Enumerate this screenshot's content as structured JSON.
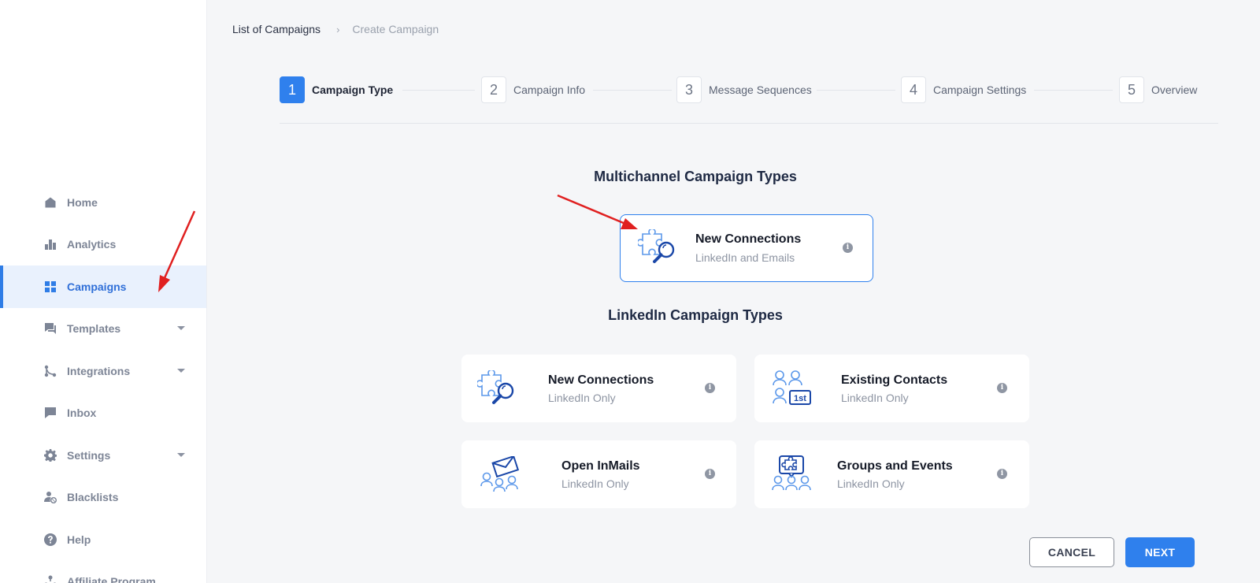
{
  "sidebar": {
    "items": [
      {
        "label": "Home",
        "icon": "home-icon"
      },
      {
        "label": "Analytics",
        "icon": "bar-chart-icon"
      },
      {
        "label": "Campaigns",
        "icon": "grid-icon",
        "active": true
      },
      {
        "label": "Templates",
        "icon": "chat-bubbles-icon",
        "expandable": true
      },
      {
        "label": "Integrations",
        "icon": "integration-icon",
        "expandable": true
      },
      {
        "label": "Inbox",
        "icon": "message-icon"
      },
      {
        "label": "Settings",
        "icon": "gear-icon",
        "expandable": true
      },
      {
        "label": "Blacklists",
        "icon": "user-block-icon"
      },
      {
        "label": "Help",
        "icon": "help-icon"
      },
      {
        "label": "Affiliate Program",
        "icon": "network-icon"
      }
    ]
  },
  "breadcrumb": {
    "parent": "List of Campaigns",
    "separator": "›",
    "current": "Create Campaign"
  },
  "stepper": {
    "steps": [
      {
        "number": "1",
        "label": "Campaign Type",
        "active": true
      },
      {
        "number": "2",
        "label": "Campaign Info"
      },
      {
        "number": "3",
        "label": "Message Sequences"
      },
      {
        "number": "4",
        "label": "Campaign Settings"
      },
      {
        "number": "5",
        "label": "Overview"
      }
    ]
  },
  "multichannel": {
    "title": "Multichannel Campaign Types",
    "cards": [
      {
        "title": "New Connections",
        "subtitle": "LinkedIn and Emails",
        "icon": "puzzle-search-icon",
        "selected": true
      }
    ]
  },
  "linkedin": {
    "title": "LinkedIn Campaign Types",
    "cards": [
      {
        "title": "New Connections",
        "subtitle": "LinkedIn Only",
        "icon": "puzzle-search-icon"
      },
      {
        "title": "Existing Contacts",
        "subtitle": "LinkedIn Only",
        "icon": "first-degree-contacts-icon"
      },
      {
        "title": "Open InMails",
        "subtitle": "LinkedIn Only",
        "icon": "envelope-people-icon"
      },
      {
        "title": "Groups and Events",
        "subtitle": "LinkedIn Only",
        "icon": "group-puzzle-icon"
      }
    ]
  },
  "info_glyph": "i",
  "badge_1st": "1st",
  "actions": {
    "cancel": "CANCEL",
    "next": "NEXT"
  },
  "colors": {
    "accent": "#2f80ed",
    "annotation_arrow": "#e02020",
    "icon_dark": "#1a47a8",
    "icon_light": "#5c98ea"
  }
}
